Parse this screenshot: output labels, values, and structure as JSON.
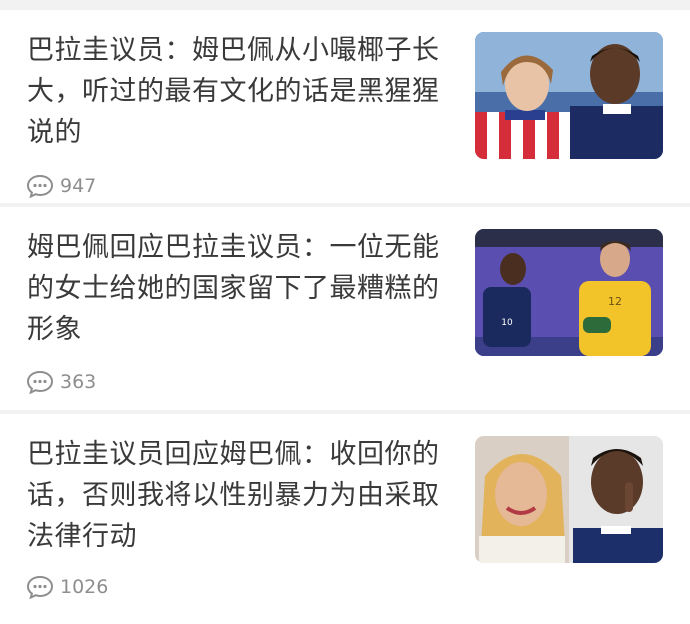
{
  "feed": {
    "items": [
      {
        "title": "巴拉圭议员：姆巴佩从小嘬椰子长大，听过的最有文化的话是黑猩猩说的",
        "comments": "947",
        "icon": "comment-icon"
      },
      {
        "title": "姆巴佩回应巴拉圭议员：一位无能的女士给她的国家留下了最糟糕的形象",
        "comments": "363",
        "icon": "comment-icon"
      },
      {
        "title": "巴拉圭议员回应姆巴佩：收回你的话，否则我将以性别暴力为由采取法律行动",
        "comments": "1026",
        "icon": "comment-icon"
      }
    ]
  },
  "colors": {
    "background": "#f2f2f2",
    "card": "#ffffff",
    "title_text": "#3a3a3a",
    "meta_text": "#8e8e8e"
  }
}
